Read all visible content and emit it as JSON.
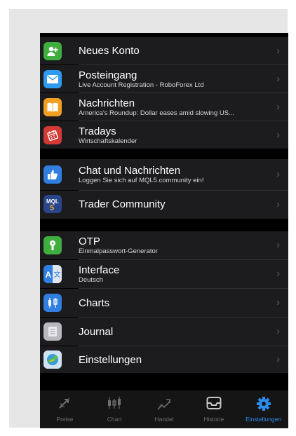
{
  "groups": [
    {
      "items": [
        {
          "title": "Neues Konto",
          "subtitle": "",
          "icon": "add-account-icon",
          "color": "#3fae3f"
        },
        {
          "title": "Posteingang",
          "subtitle": "Live Account Registration - RoboForex Ltd",
          "icon": "mail-icon",
          "color": "#2f9bf0"
        },
        {
          "title": "Nachrichten",
          "subtitle": "America's Roundup: Dollar eases amid slowing US...",
          "icon": "book-icon",
          "color": "#f0a020"
        },
        {
          "title": "Tradays",
          "subtitle": "Wirtschaftskalender",
          "icon": "calendar-icon",
          "color": "#d23a36"
        }
      ]
    },
    {
      "items": [
        {
          "title": "Chat und Nachrichten",
          "subtitle": "Loggen Sie sich auf MQL5.community ein!",
          "icon": "thumbs-up-icon",
          "color": "#2f7ee0"
        },
        {
          "title": "Trader Community",
          "subtitle": "",
          "icon": "mql5-icon",
          "color": "#28468c"
        }
      ]
    },
    {
      "items": [
        {
          "title": "OTP",
          "subtitle": "Einmalpasswort-Generator",
          "icon": "key-icon",
          "color": "#3fae3f"
        },
        {
          "title": "Interface",
          "subtitle": "Deutsch",
          "icon": "translate-icon",
          "color": "#2f7ee0"
        },
        {
          "title": "Charts",
          "subtitle": "",
          "icon": "candlestick-icon",
          "color": "#2f7ee0"
        },
        {
          "title": "Journal",
          "subtitle": "",
          "icon": "journal-icon",
          "color": "#b8b8be"
        },
        {
          "title": "Einstellungen",
          "subtitle": "",
          "icon": "settings-app-icon",
          "color": "#3a9bdc"
        }
      ]
    }
  ],
  "chevron": "›",
  "tabbar": {
    "tabs": [
      {
        "label": "Preise",
        "icon": "quotes-icon"
      },
      {
        "label": "Chart",
        "icon": "chart-icon"
      },
      {
        "label": "Handel",
        "icon": "trade-icon"
      },
      {
        "label": "Historie",
        "icon": "history-icon"
      },
      {
        "label": "Einstellungen",
        "icon": "settings-gear-icon"
      }
    ],
    "active": "Einstellungen",
    "active_color": "#2d8cf0"
  }
}
